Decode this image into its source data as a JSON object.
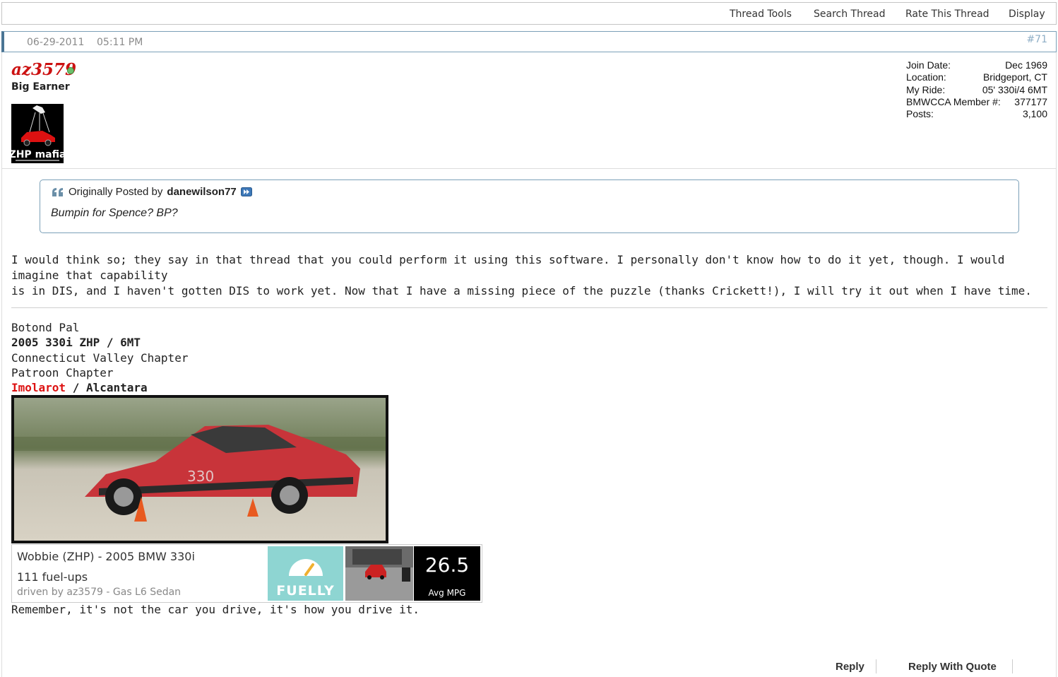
{
  "toolbar": {
    "thread_tools": "Thread Tools",
    "search_thread": "Search Thread",
    "rate_thread": "Rate This Thread",
    "display": "Display"
  },
  "post": {
    "date": "06-29-2011",
    "time": "05:11 PM",
    "number": "#71"
  },
  "user": {
    "name": "az3579",
    "title": "Big Earner",
    "avatar_text": "ZHP mafia",
    "stats": [
      {
        "label": "Join Date:",
        "value": "Dec 1969"
      },
      {
        "label": "Location:",
        "value": "Bridgeport, CT"
      },
      {
        "label": "My Ride:",
        "value": "05' 330i/4 6MT"
      },
      {
        "label": "BMWCCA Member #:",
        "value": "377177"
      },
      {
        "label": "Posts:",
        "value": "3,100"
      }
    ]
  },
  "quote": {
    "prefix": "Originally Posted by",
    "author": "danewilson77",
    "text": "Bumpin for Spence? BP?"
  },
  "message": {
    "line1": "I would think so; they say in that thread that you could perform it using this software. I personally don't know how to do it yet, though. I would imagine that capability",
    "line2": "is in DIS, and I haven't gotten DIS to work yet. Now that I have a missing piece of the puzzle (thanks Crickett!), I will try it out when I have time."
  },
  "signature": {
    "name": "Botond Pal",
    "car": "2005 330i ZHP / 6MT",
    "chapter1": "Connecticut Valley Chapter",
    "chapter2": "Patroon Chapter",
    "color1": "Imolarot",
    "color_sep": " / ",
    "color2": "Alcantara",
    "car_number": "330",
    "fuelly": {
      "title": "Wobbie (ZHP) - 2005 BMW 330i",
      "fuelups": "111 fuel-ups",
      "driver": "driven by az3579 - Gas L6 Sedan",
      "logo": "FUELLY",
      "mpg": "26.5",
      "mpg_label": "Avg MPG"
    },
    "motto": "Remember, it's not the car you drive, it's how you drive it."
  },
  "actions": {
    "reply": "Reply",
    "reply_quote": "Reply With Quote"
  },
  "colors": {
    "username": "#cc1111",
    "accent_border": "#7ba0b8",
    "imolarot": "#dd1111"
  }
}
